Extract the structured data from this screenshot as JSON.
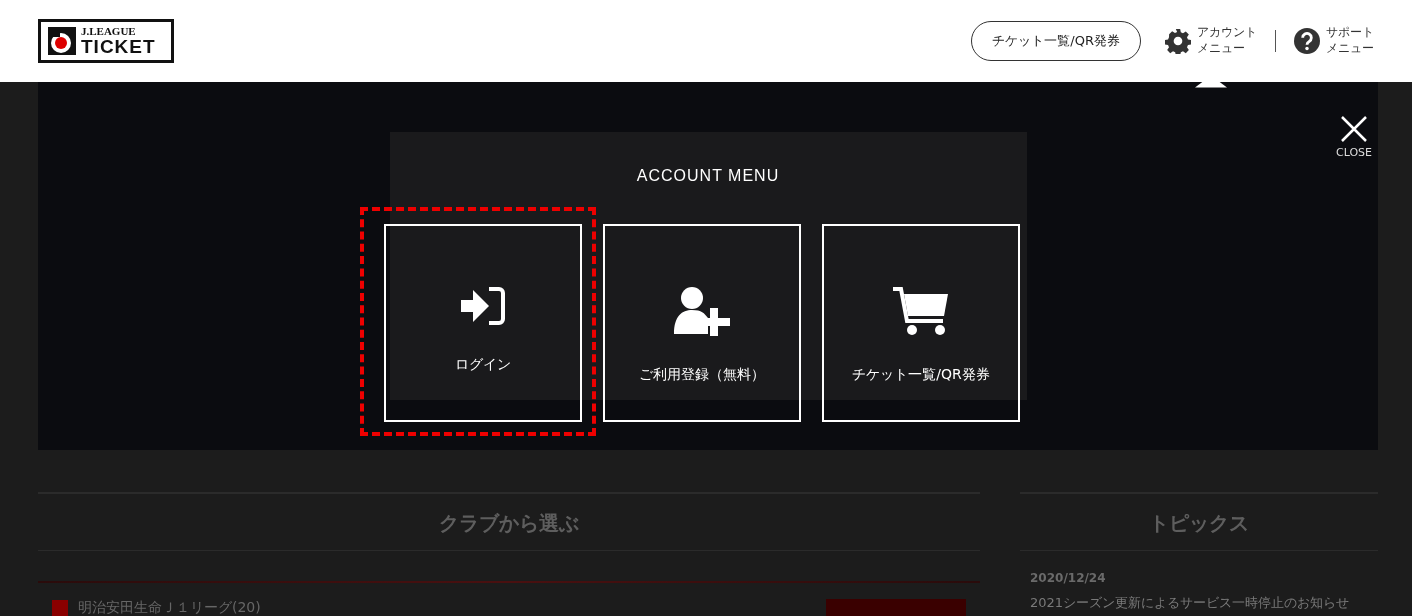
{
  "header": {
    "logo": {
      "line_1": "J.LEAGUE",
      "line_2": "TICKET"
    },
    "ticket_button": "チケット一覧/QR発券",
    "menus": [
      {
        "kind": "gear",
        "label_1": "アカウント",
        "label_2": "メニュー",
        "selected": true
      },
      {
        "kind": "help",
        "label_1": "サポート",
        "label_2": "メニュー",
        "selected": false
      }
    ]
  },
  "account_menu": {
    "title": "ACCOUNT MENU",
    "close": "CLOSE",
    "items": [
      {
        "kind": "login",
        "label": "ログイン",
        "highlighted": true
      },
      {
        "kind": "register",
        "label": "ご利用登録（無料）",
        "highlighted": false
      },
      {
        "kind": "cart",
        "label": "チケット一覧/QR発券",
        "highlighted": false
      }
    ]
  },
  "clubs": {
    "title": "クラブから選ぶ",
    "leagues": [
      {
        "name": "明治安田生命Ｊ１リーグ(20)",
        "color": "#8a0000"
      }
    ]
  },
  "topics": {
    "title": "トピックス",
    "items": [
      {
        "date": "2020/12/24",
        "text": "2021シーズン更新によるサービス一時停止のお知らせ"
      }
    ]
  }
}
